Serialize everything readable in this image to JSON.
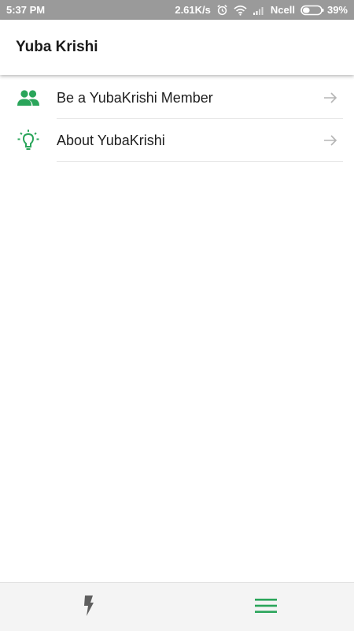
{
  "status_bar": {
    "time": "5:37 PM",
    "speed": "2.61K/s",
    "carrier": "Ncell",
    "battery": "39%",
    "battery_level": 0.39
  },
  "app_bar": {
    "title": "Yuba Krishi"
  },
  "menu": {
    "items": [
      {
        "label": "Be a YubaKrishi Member",
        "icon": "people-icon"
      },
      {
        "label": "About YubaKrishi",
        "icon": "lightbulb-icon"
      }
    ]
  },
  "bottom_nav": {
    "items": [
      {
        "icon": "flash-icon"
      },
      {
        "icon": "menu-icon"
      }
    ]
  },
  "colors": {
    "accent": "#2aa55a",
    "status_bar_bg": "#9a9a9a",
    "arrow": "#b5b5b5",
    "bottom_nav_bg": "#f4f4f4"
  }
}
